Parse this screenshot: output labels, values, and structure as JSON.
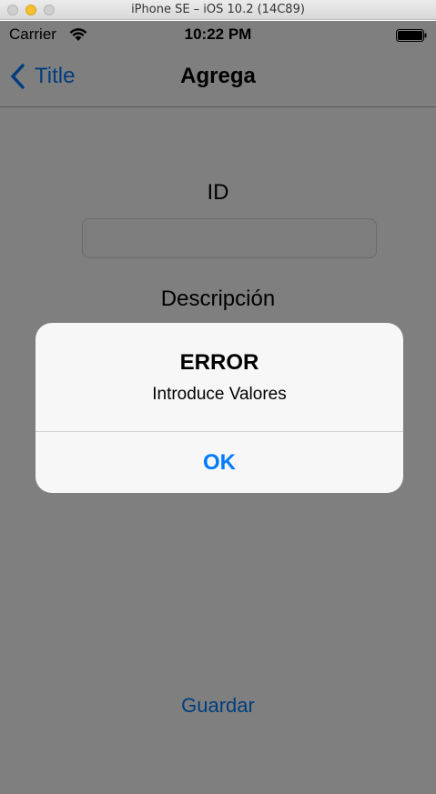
{
  "window": {
    "title": "iPhone SE – iOS 10.2 (14C89)"
  },
  "status_bar": {
    "carrier": "Carrier",
    "time": "10:22 PM"
  },
  "nav": {
    "back_label": "Title",
    "title": "Agrega"
  },
  "form": {
    "id_label": "ID",
    "id_value": "",
    "description_label": "Descripción",
    "description_value": "",
    "save_label": "Guardar"
  },
  "alert": {
    "title": "ERROR",
    "message": "Introduce Valores",
    "ok_label": "OK"
  },
  "colors": {
    "accent": "#007aff",
    "overlay": "rgba(0,0,0,0.5)"
  },
  "icons": [
    "wifi-icon",
    "battery-icon",
    "back-chevron-icon"
  ]
}
